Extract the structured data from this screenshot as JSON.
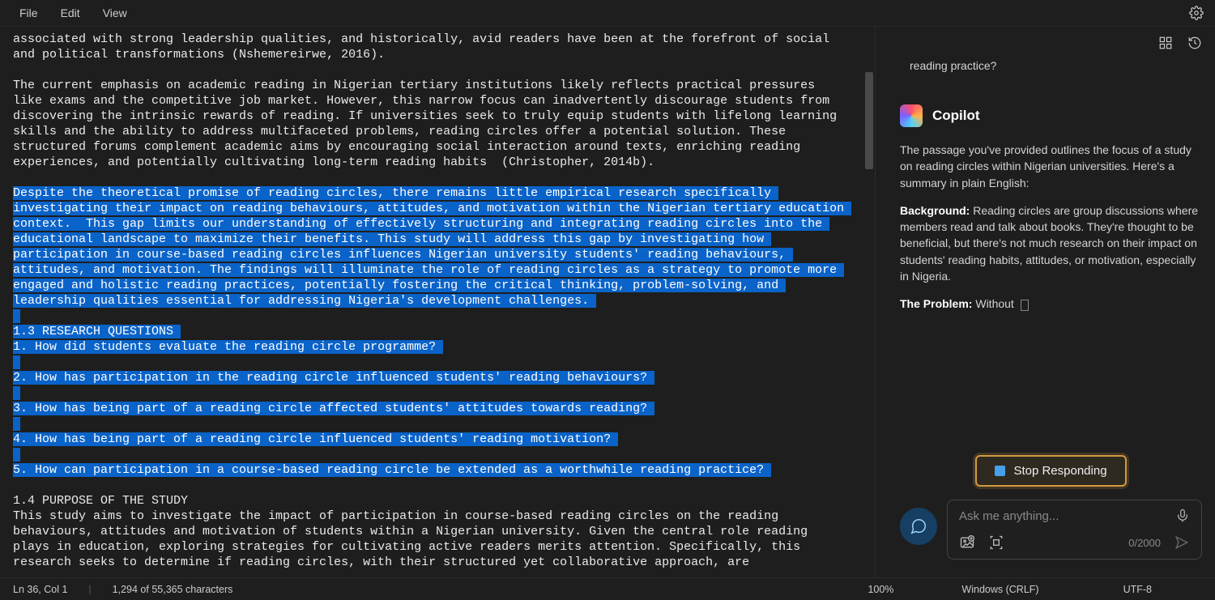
{
  "menubar": {
    "file": "File",
    "edit": "Edit",
    "view": "View"
  },
  "editor": {
    "pre_text_1": "associated with strong leadership qualities, and historically, avid readers have been at the forefront of social and political transformations (Nshemereirwe, 2016).",
    "pre_text_2": "The current emphasis on academic reading in Nigerian tertiary institutions likely reflects practical pressures like exams and the competitive job market. However, this narrow focus can inadvertently discourage students from discovering the intrinsic rewards of reading. If universities seek to truly equip students with lifelong learning skills and the ability to address multifaceted problems, reading circles offer a potential solution. These structured forums complement academic aims by encouraging social interaction around texts, enriching reading experiences, and potentially cultivating long-term reading habits  (Christopher, 2014b).",
    "sel_para": "Despite the theoretical promise of reading circles, there remains little empirical research specifically investigating their impact on reading behaviours, attitudes, and motivation within the Nigerian tertiary education context.  This gap limits our understanding of effectively structuring and integrating reading circles into the educational landscape to maximize their benefits. This study will address this gap by investigating how participation in course-based reading circles influences Nigerian university students' reading behaviours, attitudes, and motivation. The findings will illuminate the role of reading circles as a strategy to promote more engaged and holistic reading practices, potentially fostering the critical thinking, problem-solving, and leadership qualities essential for addressing Nigeria's development challenges. ",
    "sel_heading": "1.3 RESEARCH QUESTIONS ",
    "sel_q1": "1. How did students evaluate the reading circle programme? ",
    "sel_q2": "2. How has participation in the reading circle influenced students' reading behaviours? ",
    "sel_q3": "3. How has being part of a reading circle affected students' attitudes towards reading? ",
    "sel_q4": "4. How has being part of a reading circle influenced students' reading motivation? ",
    "sel_q5": "5. How can participation in a course-based reading circle be extended as a worthwhile reading practice? ",
    "post_heading": "1.4 PURPOSE OF THE STUDY",
    "post_text": "This study aims to investigate the impact of participation in course-based reading circles on the reading behaviours, attitudes and motivation of students within a Nigerian university. Given the central role reading plays in education, exploring strategies for cultivating active readers merits attention. Specifically, this research seeks to determine if reading circles, with their structured yet collaborative approach, are"
  },
  "copilot": {
    "truncated_tail": "reading practice?",
    "title": "Copilot",
    "intro": "The passage you've provided outlines the focus of a study on reading circles within Nigerian universities. Here's a summary in plain English:",
    "bg_label": "Background:",
    "bg_text": " Reading circles are group discussions where members read and talk about books. They're thought to be beneficial, but there's not much research on their impact on students' reading habits, attitudes, or motivation, especially in Nigeria.",
    "prob_label": "The Problem:",
    "prob_text": " Without ",
    "stop_label": "Stop Responding",
    "input_placeholder": "Ask me anything...",
    "char_count": "0/2000"
  },
  "statusbar": {
    "pos": "Ln 36, Col 1",
    "sel": "1,294 of 55,365 characters",
    "zoom": "100%",
    "eol": "Windows (CRLF)",
    "encoding": "UTF-8"
  }
}
